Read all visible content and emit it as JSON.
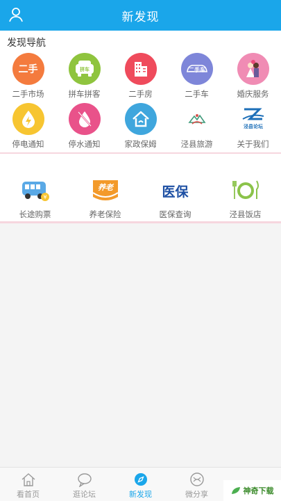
{
  "header": {
    "title": "新发现"
  },
  "section": {
    "title": "发现导航"
  },
  "nav_row1": [
    {
      "label": "二手市场",
      "icon": "second-hand-market-icon",
      "glyph": "二手",
      "color": "#f47b3e"
    },
    {
      "label": "拼车拼客",
      "icon": "carpool-icon",
      "glyph": "拼车",
      "color": "#8fc43e"
    },
    {
      "label": "二手房",
      "icon": "second-hand-house-icon",
      "glyph": "",
      "color": "#ef4b5c"
    },
    {
      "label": "二手车",
      "icon": "second-hand-car-icon",
      "glyph": "二手车",
      "color": "#7e86d9"
    },
    {
      "label": "婚庆服务",
      "icon": "wedding-service-icon",
      "glyph": "",
      "color": "#f08cb4"
    }
  ],
  "nav_row2": [
    {
      "label": "停电通知",
      "icon": "power-outage-icon",
      "glyph": "",
      "color": "#f7c531"
    },
    {
      "label": "停水通知",
      "icon": "water-outage-icon",
      "glyph": "",
      "color": "#e9528a"
    },
    {
      "label": "家政保姆",
      "icon": "housekeeping-icon",
      "glyph": "",
      "color": "#3fa6dd"
    },
    {
      "label": "泾县旅游",
      "icon": "tourism-icon",
      "glyph": "",
      "color": "#ffffff"
    },
    {
      "label": "关于我们",
      "icon": "about-us-icon",
      "glyph": "泾县论坛",
      "color": "#ffffff"
    }
  ],
  "services": [
    {
      "label": "长途购票",
      "icon": "bus-ticket-icon"
    },
    {
      "label": "养老保险",
      "icon": "pension-insurance-icon",
      "glyph": "养老"
    },
    {
      "label": "医保查询",
      "icon": "medical-insurance-icon",
      "glyph": "医保"
    },
    {
      "label": "泾县饭店",
      "icon": "restaurant-icon"
    }
  ],
  "tabs": [
    {
      "label": "看首页",
      "icon": "home-icon"
    },
    {
      "label": "逛论坛",
      "icon": "forum-icon"
    },
    {
      "label": "新发现",
      "icon": "discover-icon",
      "active": true
    },
    {
      "label": "微分享",
      "icon": "share-icon"
    }
  ],
  "watermark": {
    "text": "神奇下载"
  }
}
